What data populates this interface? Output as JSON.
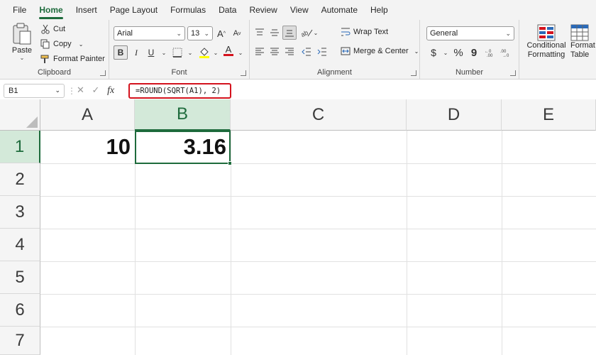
{
  "menu": {
    "tabs": [
      "File",
      "Home",
      "Insert",
      "Page Layout",
      "Formulas",
      "Data",
      "Review",
      "View",
      "Automate",
      "Help"
    ],
    "active_tab": "Home"
  },
  "ribbon": {
    "clipboard": {
      "paste": "Paste",
      "cut": "Cut",
      "copy": "Copy",
      "format_painter": "Format Painter",
      "label": "Clipboard"
    },
    "font": {
      "font_name": "Arial",
      "font_size": "13",
      "grow": "A",
      "shrink": "A",
      "bold": "B",
      "italic": "I",
      "underline": "U",
      "font_color_letter": "A",
      "label": "Font"
    },
    "alignment": {
      "wrap_text": "Wrap Text",
      "merge_center": "Merge & Center",
      "label": "Alignment"
    },
    "number": {
      "format": "General",
      "currency": "$",
      "percent": "%",
      "comma": "9",
      "label": "Number"
    },
    "styles": {
      "conditional_line1": "Conditional",
      "conditional_line2": "Formatting",
      "format_table_line1": "Format",
      "format_table_line2": "Table"
    }
  },
  "formula_bar": {
    "name_box": "B1",
    "fx": "fx",
    "formula": "=ROUND(SQRT(A1), 2)"
  },
  "sheet": {
    "columns": [
      "A",
      "B",
      "C",
      "D",
      "E"
    ],
    "rows": [
      "1",
      "2",
      "3",
      "4",
      "5",
      "6",
      "7"
    ],
    "cells": {
      "A1": "10",
      "B1": "3.16"
    },
    "selected_cell": "B1"
  },
  "colors": {
    "accent_green": "#1e6b3c",
    "highlight_red": "#d4131e"
  }
}
